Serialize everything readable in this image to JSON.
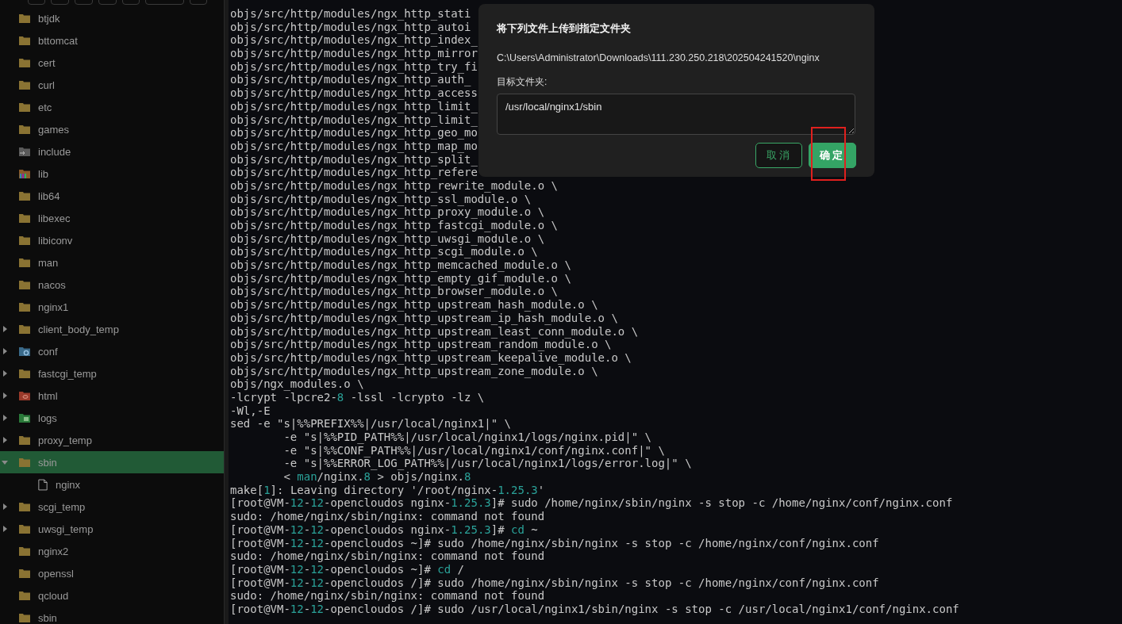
{
  "tree": [
    {
      "name": "btjdk",
      "kind": "folder"
    },
    {
      "name": "bttomcat",
      "kind": "folder"
    },
    {
      "name": "cert",
      "kind": "folder"
    },
    {
      "name": "curl",
      "kind": "folder"
    },
    {
      "name": "etc",
      "kind": "folder"
    },
    {
      "name": "games",
      "kind": "folder"
    },
    {
      "name": "include",
      "kind": "link"
    },
    {
      "name": "lib",
      "kind": "library"
    },
    {
      "name": "lib64",
      "kind": "folder"
    },
    {
      "name": "libexec",
      "kind": "folder"
    },
    {
      "name": "libiconv",
      "kind": "folder"
    },
    {
      "name": "man",
      "kind": "folder"
    },
    {
      "name": "nacos",
      "kind": "folder"
    },
    {
      "name": "nginx1",
      "kind": "folder",
      "children": [
        {
          "name": "client_body_temp",
          "kind": "folder",
          "expanded": false,
          "selected": false
        },
        {
          "name": "conf",
          "kind": "config",
          "expanded": false,
          "selected": false
        },
        {
          "name": "fastcgi_temp",
          "kind": "folder",
          "expanded": false,
          "selected": false
        },
        {
          "name": "html",
          "kind": "web",
          "expanded": false,
          "selected": false
        },
        {
          "name": "logs",
          "kind": "log",
          "expanded": false,
          "selected": false
        },
        {
          "name": "proxy_temp",
          "kind": "folder",
          "expanded": false,
          "selected": false
        },
        {
          "name": "sbin",
          "kind": "folder",
          "expanded": true,
          "selected": true,
          "children": [
            {
              "name": "nginx",
              "kind": "file"
            }
          ]
        },
        {
          "name": "scgi_temp",
          "kind": "folder",
          "expanded": false,
          "selected": false
        },
        {
          "name": "uwsgi_temp",
          "kind": "folder",
          "expanded": false,
          "selected": false
        }
      ]
    },
    {
      "name": "nginx2",
      "kind": "folder"
    },
    {
      "name": "openssl",
      "kind": "folder"
    },
    {
      "name": "qcloud",
      "kind": "folder"
    },
    {
      "name": "sbin",
      "kind": "folder"
    }
  ],
  "terminal": {
    "lines": [
      "objs/src/http/modules/ngx_http_stati",
      "objs/src/http/modules/ngx_http_autoi",
      "objs/src/http/modules/ngx_http_index_",
      "objs/src/http/modules/ngx_http_mirror",
      "objs/src/http/modules/ngx_http_try_fi",
      "objs/src/http/modules/ngx_http_auth_",
      "objs/src/http/modules/ngx_http_access",
      "objs/src/http/modules/ngx_http_limit_",
      "objs/src/http/modules/ngx_http_limit_",
      "objs/src/http/modules/ngx_http_geo_mo",
      "objs/src/http/modules/ngx_http_map_mo",
      "objs/src/http/modules/ngx_http_split_",
      "objs/src/http/modules/ngx_http_refere",
      "objs/src/http/modules/ngx_http_rewrite_module.o \\",
      "objs/src/http/modules/ngx_http_ssl_module.o \\",
      "objs/src/http/modules/ngx_http_proxy_module.o \\",
      "objs/src/http/modules/ngx_http_fastcgi_module.o \\",
      "objs/src/http/modules/ngx_http_uwsgi_module.o \\",
      "objs/src/http/modules/ngx_http_scgi_module.o \\",
      "objs/src/http/modules/ngx_http_memcached_module.o \\",
      "objs/src/http/modules/ngx_http_empty_gif_module.o \\",
      "objs/src/http/modules/ngx_http_browser_module.o \\",
      "objs/src/http/modules/ngx_http_upstream_hash_module.o \\",
      "objs/src/http/modules/ngx_http_upstream_ip_hash_module.o \\",
      "objs/src/http/modules/ngx_http_upstream_least_conn_module.o \\",
      "objs/src/http/modules/ngx_http_upstream_random_module.o \\",
      "objs/src/http/modules/ngx_http_upstream_keepalive_module.o \\",
      "objs/src/http/modules/ngx_http_upstream_zone_module.o \\",
      "objs/ngx_modules.o \\",
      [
        {
          "text": "-lcrypt -lpcre2-",
          "accent": false
        },
        {
          "text": "8",
          "accent": true
        },
        {
          "text": " -lssl -lcrypto -lz \\",
          "accent": false
        }
      ],
      "-Wl,-E",
      "sed -e \"s|%%PREFIX%%|/usr/local/nginx1|\" \\",
      "        -e \"s|%%PID_PATH%%|/usr/local/nginx1/logs/nginx.pid|\" \\",
      "        -e \"s|%%CONF_PATH%%|/usr/local/nginx1/conf/nginx.conf|\" \\",
      "        -e \"s|%%ERROR_LOG_PATH%%|/usr/local/nginx1/logs/error.log|\" \\",
      [
        {
          "text": "        < ",
          "accent": false
        },
        {
          "text": "man",
          "accent": true
        },
        {
          "text": "/nginx.",
          "accent": false
        },
        {
          "text": "8",
          "accent": true
        },
        {
          "text": " > objs/nginx.",
          "accent": false
        },
        {
          "text": "8",
          "accent": true
        }
      ],
      [
        {
          "text": "make[",
          "accent": false
        },
        {
          "text": "1",
          "accent": true
        },
        {
          "text": "]: Leaving directory '/root/nginx-",
          "accent": false
        },
        {
          "text": "1.25.3",
          "accent": true
        },
        {
          "text": "'",
          "accent": false
        }
      ],
      [
        {
          "text": "[root@VM-",
          "accent": false
        },
        {
          "text": "12",
          "accent": true
        },
        {
          "text": "-",
          "accent": false
        },
        {
          "text": "12",
          "accent": true
        },
        {
          "text": "-opencloudos nginx-",
          "accent": false
        },
        {
          "text": "1.25.3",
          "accent": true
        },
        {
          "text": "]# sudo /home/nginx/sbin/nginx -s stop -c /home/nginx/conf/nginx.conf",
          "accent": false
        }
      ],
      "sudo: /home/nginx/sbin/nginx: command not found",
      [
        {
          "text": "[root@VM-",
          "accent": false
        },
        {
          "text": "12",
          "accent": true
        },
        {
          "text": "-",
          "accent": false
        },
        {
          "text": "12",
          "accent": true
        },
        {
          "text": "-opencloudos nginx-",
          "accent": false
        },
        {
          "text": "1.25.3",
          "accent": true
        },
        {
          "text": "]# ",
          "accent": false
        },
        {
          "text": "cd",
          "accent": true
        },
        {
          "text": " ~",
          "accent": false
        }
      ],
      [
        {
          "text": "[root@VM-",
          "accent": false
        },
        {
          "text": "12",
          "accent": true
        },
        {
          "text": "-",
          "accent": false
        },
        {
          "text": "12",
          "accent": true
        },
        {
          "text": "-opencloudos ~]# sudo /home/nginx/sbin/nginx -s stop -c /home/nginx/conf/nginx.conf",
          "accent": false
        }
      ],
      "sudo: /home/nginx/sbin/nginx: command not found",
      [
        {
          "text": "[root@VM-",
          "accent": false
        },
        {
          "text": "12",
          "accent": true
        },
        {
          "text": "-",
          "accent": false
        },
        {
          "text": "12",
          "accent": true
        },
        {
          "text": "-opencloudos ~]# ",
          "accent": false
        },
        {
          "text": "cd",
          "accent": true
        },
        {
          "text": " /",
          "accent": false
        }
      ],
      [
        {
          "text": "[root@VM-",
          "accent": false
        },
        {
          "text": "12",
          "accent": true
        },
        {
          "text": "-",
          "accent": false
        },
        {
          "text": "12",
          "accent": true
        },
        {
          "text": "-opencloudos /]# sudo /home/nginx/sbin/nginx -s stop -c /home/nginx/conf/nginx.conf",
          "accent": false
        }
      ],
      "sudo: /home/nginx/sbin/nginx: command not found",
      [
        {
          "text": "[root@VM-",
          "accent": false
        },
        {
          "text": "12",
          "accent": true
        },
        {
          "text": "-",
          "accent": false
        },
        {
          "text": "12",
          "accent": true
        },
        {
          "text": "-opencloudos /]# sudo /usr/local/nginx1/sbin/nginx -s stop -c /usr/local/nginx1/conf/nginx.conf",
          "accent": false
        }
      ]
    ]
  },
  "dialog": {
    "title": "将下列文件上传到指定文件夹",
    "source_path": "C:\\Users\\Administrator\\Downloads\\111.230.250.218\\202504241520\\nginx",
    "target_label": "目标文件夹:",
    "target_value": "/usr/local/nginx1/sbin",
    "buttons": [
      {
        "label": "取消",
        "kind": "secondary"
      },
      {
        "label": "确定",
        "kind": "primary"
      }
    ]
  }
}
